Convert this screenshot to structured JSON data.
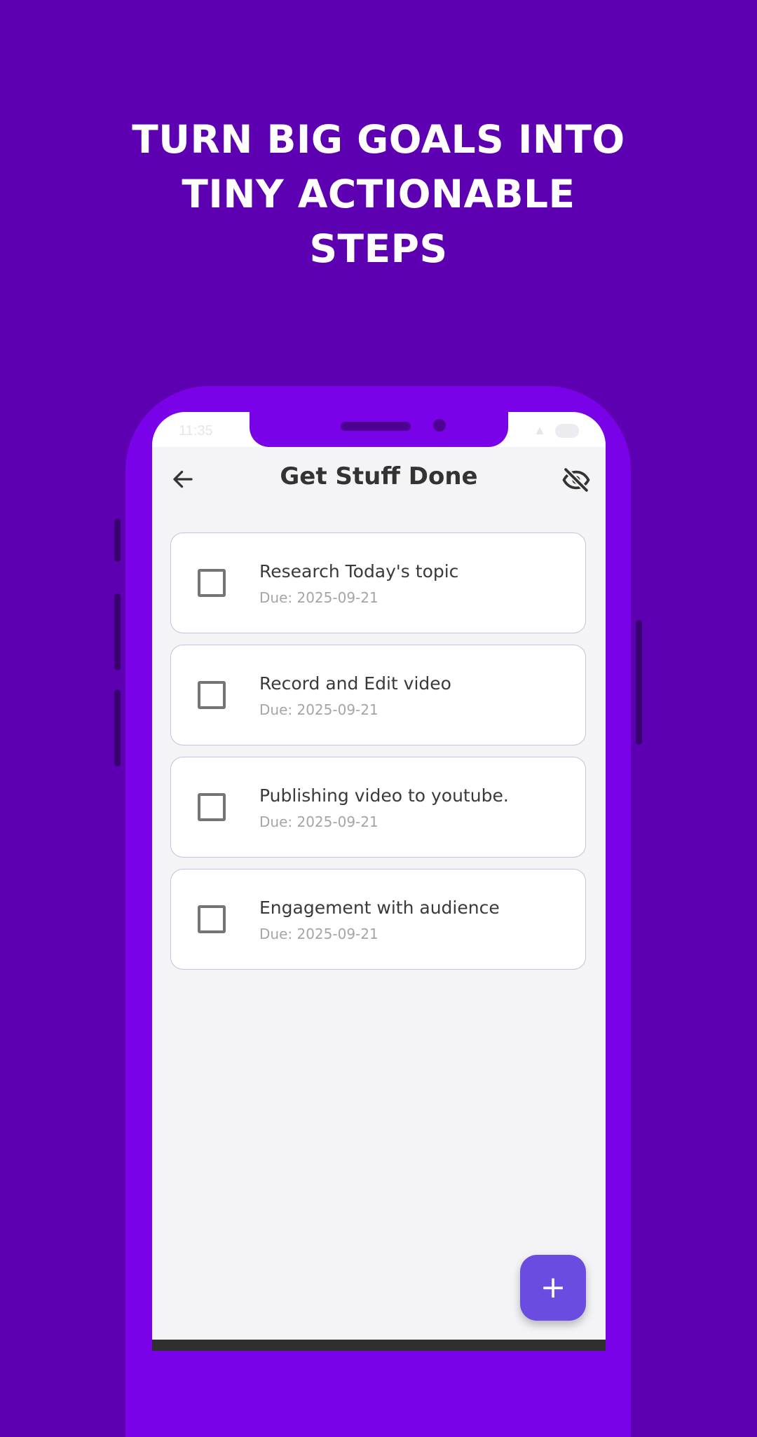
{
  "headline": {
    "lines": [
      "TURN BIG GOALS INTO",
      "TINY ACTIONABLE",
      "STEPS"
    ]
  },
  "status_bar": {
    "time": "11:35"
  },
  "app_bar": {
    "title": "Get Stuff Done",
    "back_icon": "arrow-left-icon",
    "visibility_icon": "eye-off-icon"
  },
  "tasks": [
    {
      "title": "Research Today's topic",
      "due": "Due: 2025-09-21",
      "checked": false
    },
    {
      "title": "Record and Edit video",
      "due": "Due: 2025-09-21",
      "checked": false
    },
    {
      "title": "Publishing video to youtube.",
      "due": "Due: 2025-09-21",
      "checked": false
    },
    {
      "title": "Engagement with audience",
      "due": "Due: 2025-09-21",
      "checked": false
    }
  ],
  "fab": {
    "icon": "plus-icon",
    "symbol": "+"
  },
  "colors": {
    "background": "#5d00b1",
    "phone_frame": "#7a02e8",
    "screen": "#f4f4f7",
    "fab": "#6b4ce0",
    "title_text": "#333333"
  }
}
